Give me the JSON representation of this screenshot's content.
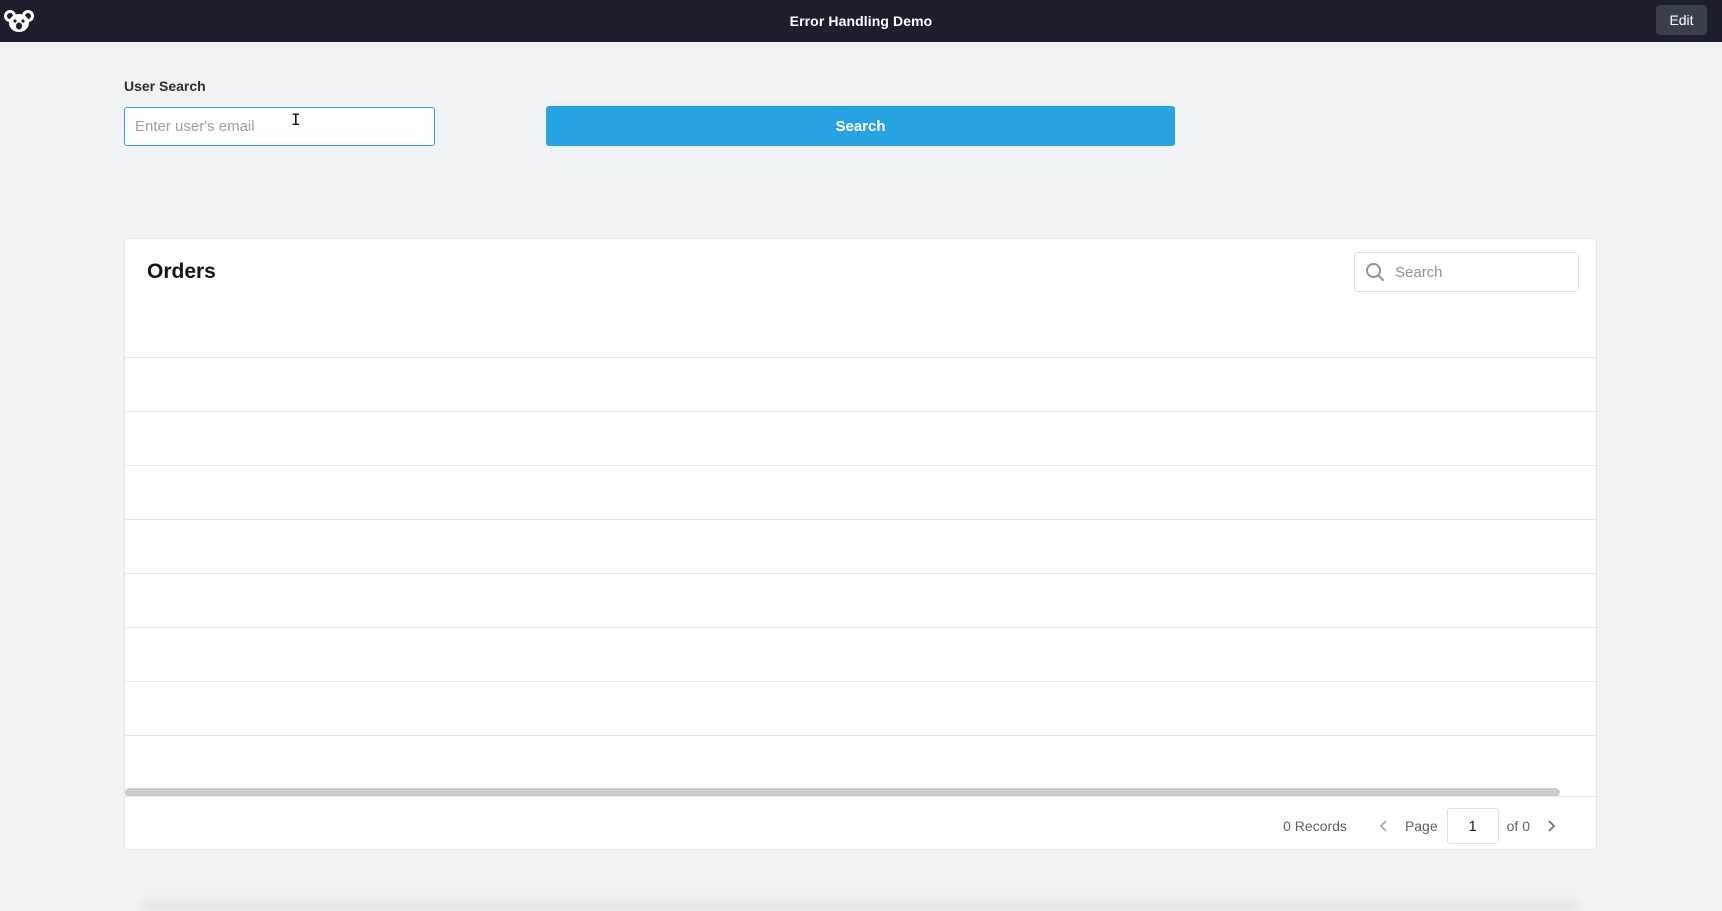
{
  "header": {
    "title": "Error Handling Demo",
    "edit_label": "Edit",
    "logo_icon": "koala-logo-icon"
  },
  "user_search": {
    "label": "User Search",
    "placeholder": "Enter user's email",
    "button_label": "Search"
  },
  "orders": {
    "title": "Orders",
    "search_placeholder": "Search",
    "row_count_visible": 8,
    "footer": {
      "records": "0 Records",
      "page_label": "Page",
      "page_value": "1",
      "of_label": "of 0"
    }
  },
  "colors": {
    "topbar": "#1c202a",
    "accent": "#27a2e3",
    "background": "#f0f3f6"
  }
}
